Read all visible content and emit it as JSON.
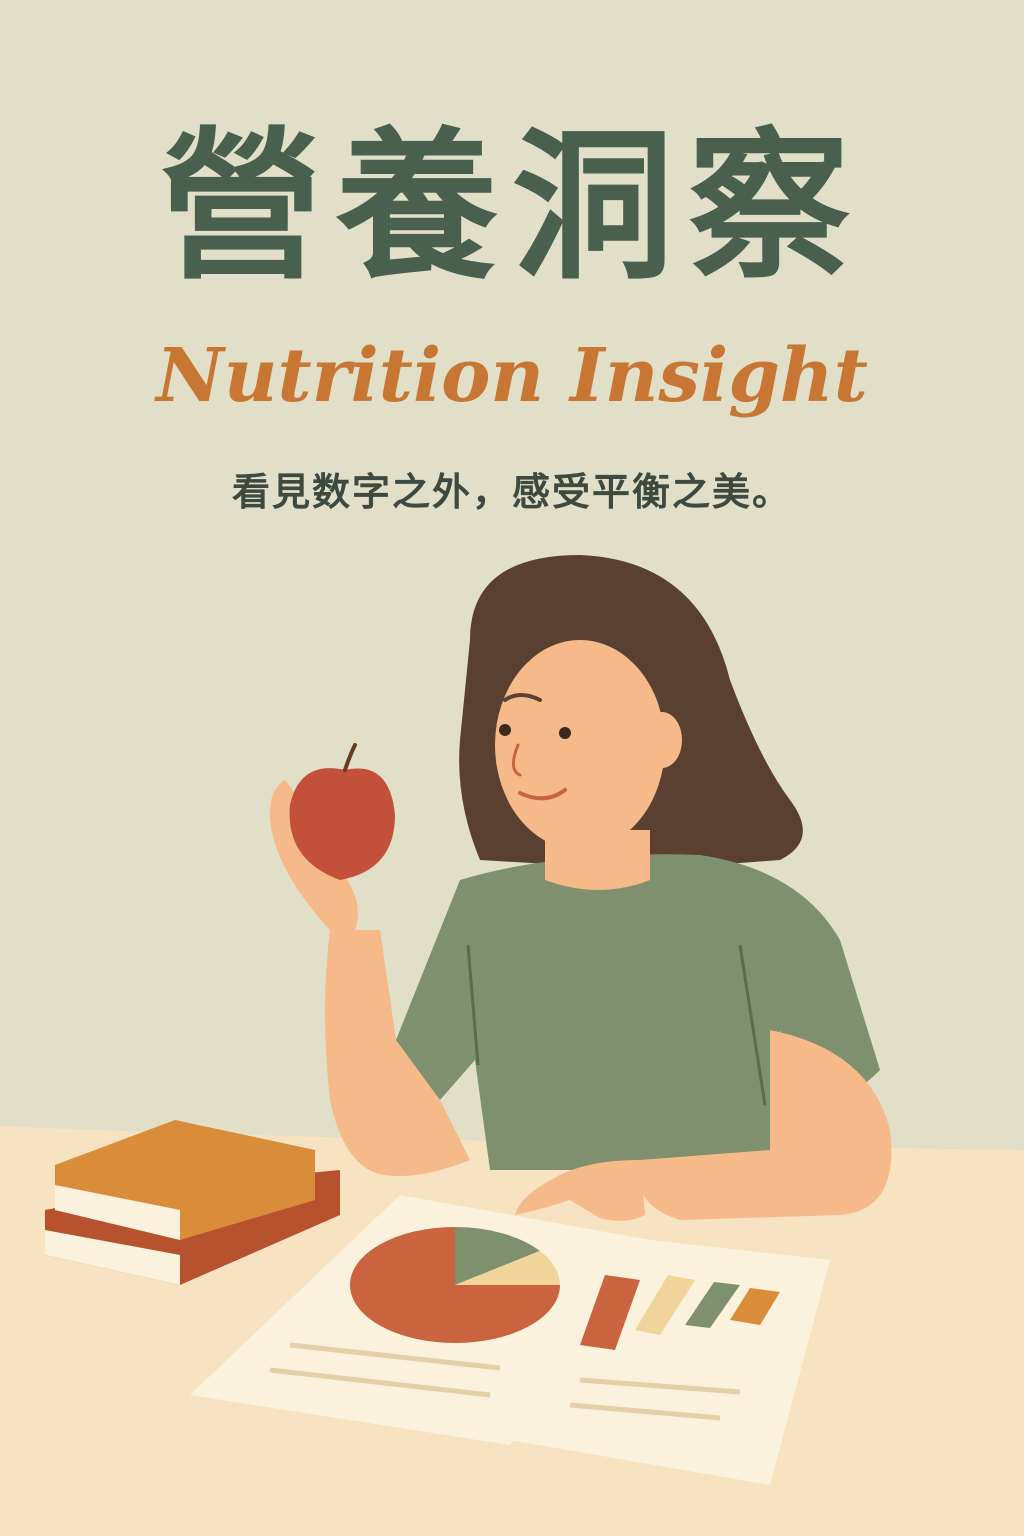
{
  "poster": {
    "title": "營養洞察",
    "subtitle": "Nutrition Insight",
    "tagline": "看見数字之外，感受平衡之美。"
  },
  "colors": {
    "background": "#e1dfc7",
    "title": "#49604f",
    "subtitle": "#c87633",
    "tagline": "#3e4a40",
    "desk": "#f7e3c2",
    "shirt": "#7e906d",
    "hair": "#5a4030",
    "skin": "#f5b98a",
    "apple": "#c2503a"
  },
  "illustration": {
    "subject": "woman holding apple",
    "pie_chart": {
      "slices": [
        {
          "color": "#c9643f",
          "fraction": 0.75
        },
        {
          "color": "#7e906d",
          "fraction": 0.15
        },
        {
          "color": "#f1d49a",
          "fraction": 0.1
        }
      ]
    },
    "bar_swatches": [
      "#c9643f",
      "#f1d49a",
      "#7e906d",
      "#d98c3a"
    ]
  }
}
